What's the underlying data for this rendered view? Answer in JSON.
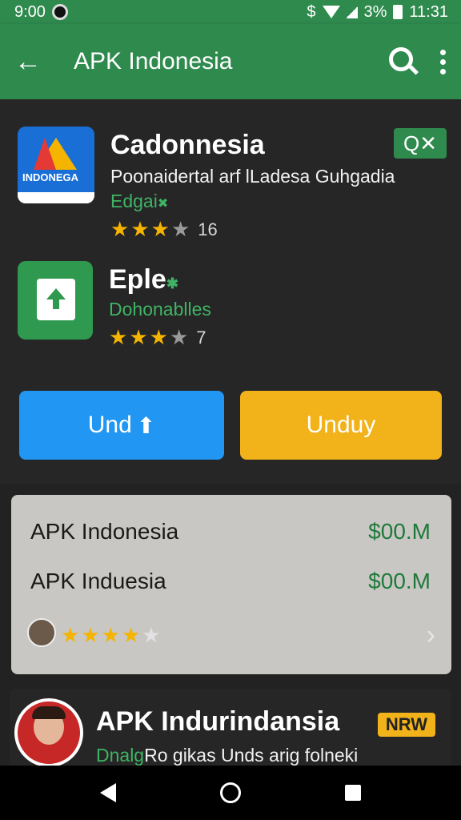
{
  "status_bar": {
    "time": "9:00",
    "dollar": "$",
    "battery": "3%",
    "clock": "11:31"
  },
  "app_bar": {
    "back": "←",
    "title": "APK Indonesia"
  },
  "apps": [
    {
      "name": "Cadonnesia",
      "icon_text": "INDONEGA",
      "description": "Poonaidertal arf lLadesa Guhgadia",
      "category": "Edgai",
      "category_mark": "✖",
      "stars": 3,
      "rating": "16",
      "badge": "Q✕"
    },
    {
      "name": "Eple",
      "name_mark": "✱",
      "description": "Dohonablles",
      "stars": 3,
      "rating": "7"
    }
  ],
  "buttons": {
    "left_label": "Und",
    "left_icon": "⬆",
    "right_label": "Unduy"
  },
  "listing_card": {
    "rows": [
      {
        "name": "APK Indonesia",
        "price": "$00.M"
      },
      {
        "name": "APK Induesia",
        "price": "$00.M"
      }
    ],
    "stars": 4,
    "chevron": "›"
  },
  "featured": {
    "title": "APK Indurindansia",
    "badge": "NRW",
    "sub_prefix": "Dnalg",
    "sub_rest": "Ro gikas Unds arig folneki"
  },
  "icons": {
    "back": "arrow-left-icon",
    "search": "search-icon",
    "menu": "more-vert-icon",
    "upload": "upload-icon",
    "chevron": "chevron-right-icon"
  },
  "colors": {
    "primary": "#2f8a4e",
    "blue_button": "#2196f3",
    "yellow_button": "#f2b21a",
    "star": "#f5b400"
  }
}
